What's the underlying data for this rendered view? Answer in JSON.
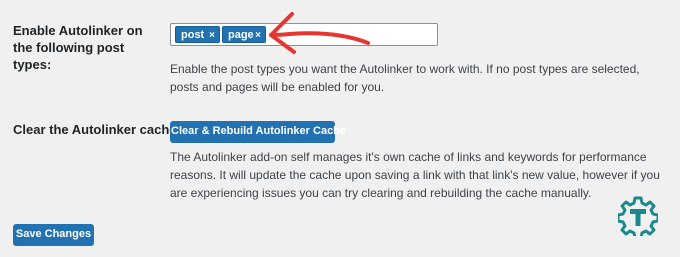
{
  "post_types": {
    "label": "Enable Autolinker on the following post types:",
    "tokens": [
      {
        "label": "post",
        "remove": "×"
      },
      {
        "label": "page",
        "remove": "×"
      }
    ],
    "description": "Enable the post types you want the Autolinker to work with. If no post types are selected, posts and pages will be enabled for you."
  },
  "cache": {
    "label": "Clear the Autolinker cache?",
    "button_label": "Clear & Rebuild Autolinker Cache",
    "description": "The Autolinker add-on self manages it's own cache of links and keywords for performance reasons. It will update the cache upon saving a link with that link's new value, however if you are experiencing issues you can try clearing and rebuilding the cache manually."
  },
  "footer": {
    "save_label": "Save Changes"
  },
  "annotation": {
    "arrow_color": "#e8352e"
  },
  "colors": {
    "primary": "#2271b1",
    "logo_teal": "#1a8a8c"
  },
  "icons": {
    "logo": "gear-t-logo-icon",
    "arrow": "red-arrow-annotation-icon"
  }
}
